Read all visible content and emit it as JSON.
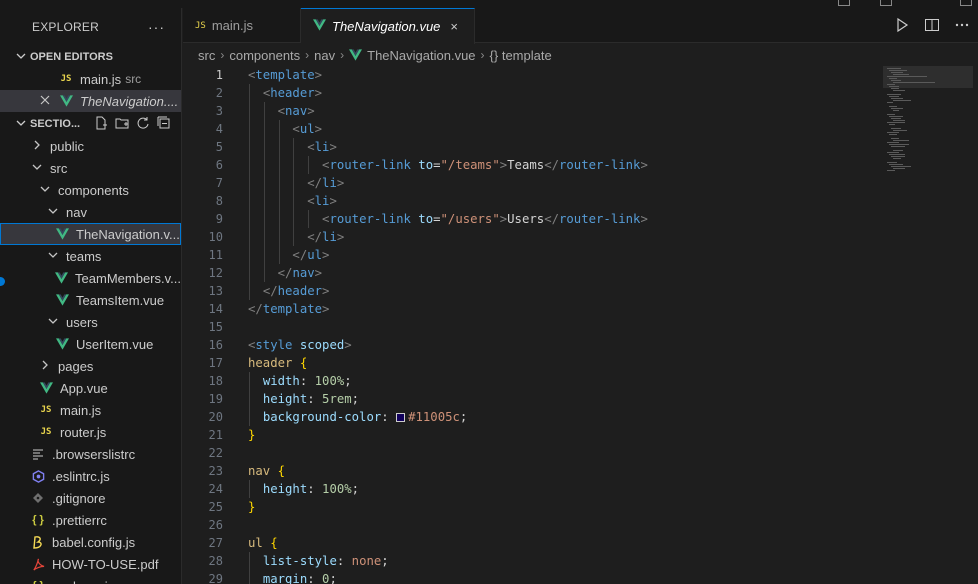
{
  "explorer": {
    "title": "EXPLORER",
    "more": "···"
  },
  "open_editors": {
    "heading": "OPEN EDITORS",
    "items": [
      {
        "name": "main.js",
        "detail": "src",
        "icon": "js-icon"
      },
      {
        "name": "TheNavigation....",
        "detail": "",
        "icon": "vue-icon"
      }
    ]
  },
  "workspace": {
    "heading": "SECTIO...",
    "tree": [
      {
        "label": "public",
        "type": "folder",
        "expanded": false,
        "indent": 1
      },
      {
        "label": "src",
        "type": "folder",
        "expanded": true,
        "indent": 1
      },
      {
        "label": "components",
        "type": "folder",
        "expanded": true,
        "indent": 2
      },
      {
        "label": "nav",
        "type": "folder",
        "expanded": true,
        "indent": 3
      },
      {
        "label": "TheNavigation.v...",
        "type": "vue",
        "indent": 4,
        "focused": true
      },
      {
        "label": "teams",
        "type": "folder",
        "expanded": true,
        "indent": 3
      },
      {
        "label": "TeamMembers.v...",
        "type": "vue",
        "indent": 4
      },
      {
        "label": "TeamsItem.vue",
        "type": "vue",
        "indent": 4
      },
      {
        "label": "users",
        "type": "folder",
        "expanded": true,
        "indent": 3
      },
      {
        "label": "UserItem.vue",
        "type": "vue",
        "indent": 4
      },
      {
        "label": "pages",
        "type": "folder",
        "expanded": false,
        "indent": 2
      },
      {
        "label": "App.vue",
        "type": "vue",
        "indent": 2
      },
      {
        "label": "main.js",
        "type": "js",
        "indent": 2
      },
      {
        "label": "router.js",
        "type": "js",
        "indent": 2
      },
      {
        "label": ".browserslistrc",
        "type": "lines",
        "indent": 1
      },
      {
        "label": ".eslintrc.js",
        "type": "eslint",
        "indent": 1
      },
      {
        "label": ".gitignore",
        "type": "git",
        "indent": 1
      },
      {
        "label": ".prettierrc",
        "type": "braces",
        "indent": 1
      },
      {
        "label": "babel.config.js",
        "type": "babel",
        "indent": 1
      },
      {
        "label": "HOW-TO-USE.pdf",
        "type": "pdf",
        "indent": 1
      },
      {
        "label": "package.json",
        "type": "braces",
        "indent": 1
      }
    ]
  },
  "tabs": [
    {
      "label": "main.js",
      "icon": "js-icon",
      "active": false
    },
    {
      "label": "TheNavigation.vue",
      "icon": "vue-icon",
      "active": true,
      "close": "×"
    }
  ],
  "breadcrumb": [
    "src",
    "components",
    "nav",
    "TheNavigation.vue",
    "{} template"
  ],
  "icon_labels": {
    "js": "JS",
    "braces": "{ }"
  },
  "code": {
    "current_line": 1,
    "lines": [
      {
        "n": "1",
        "ind": 0,
        "toks": [
          [
            "br",
            "<"
          ],
          [
            "tag",
            "template"
          ],
          [
            "br",
            ">"
          ]
        ]
      },
      {
        "n": "2",
        "ind": 1,
        "toks": [
          [
            "br",
            "<"
          ],
          [
            "tag",
            "header"
          ],
          [
            "br",
            ">"
          ]
        ]
      },
      {
        "n": "3",
        "ind": 2,
        "toks": [
          [
            "br",
            "<"
          ],
          [
            "tag",
            "nav"
          ],
          [
            "br",
            ">"
          ]
        ]
      },
      {
        "n": "4",
        "ind": 3,
        "toks": [
          [
            "br",
            "<"
          ],
          [
            "tag",
            "ul"
          ],
          [
            "br",
            ">"
          ]
        ]
      },
      {
        "n": "5",
        "ind": 4,
        "toks": [
          [
            "br",
            "<"
          ],
          [
            "tag",
            "li"
          ],
          [
            "br",
            ">"
          ]
        ]
      },
      {
        "n": "6",
        "ind": 5,
        "toks": [
          [
            "br",
            "<"
          ],
          [
            "tag",
            "router-link"
          ],
          [
            "txt",
            " "
          ],
          [
            "attr",
            "to"
          ],
          [
            "txt",
            "="
          ],
          [
            "str",
            "\"/teams\""
          ],
          [
            "br",
            ">"
          ],
          [
            "txt",
            "Teams"
          ],
          [
            "br",
            "</"
          ],
          [
            "tag",
            "router-link"
          ],
          [
            "br",
            ">"
          ]
        ]
      },
      {
        "n": "7",
        "ind": 4,
        "toks": [
          [
            "br",
            "</"
          ],
          [
            "tag",
            "li"
          ],
          [
            "br",
            ">"
          ]
        ]
      },
      {
        "n": "8",
        "ind": 4,
        "toks": [
          [
            "br",
            "<"
          ],
          [
            "tag",
            "li"
          ],
          [
            "br",
            ">"
          ]
        ]
      },
      {
        "n": "9",
        "ind": 5,
        "toks": [
          [
            "br",
            "<"
          ],
          [
            "tag",
            "router-link"
          ],
          [
            "txt",
            " "
          ],
          [
            "attr",
            "to"
          ],
          [
            "txt",
            "="
          ],
          [
            "str",
            "\"/users\""
          ],
          [
            "br",
            ">"
          ],
          [
            "txt",
            "Users"
          ],
          [
            "br",
            "</"
          ],
          [
            "tag",
            "router-link"
          ],
          [
            "br",
            ">"
          ]
        ]
      },
      {
        "n": "10",
        "ind": 4,
        "toks": [
          [
            "br",
            "</"
          ],
          [
            "tag",
            "li"
          ],
          [
            "br",
            ">"
          ]
        ]
      },
      {
        "n": "11",
        "ind": 3,
        "toks": [
          [
            "br",
            "</"
          ],
          [
            "tag",
            "ul"
          ],
          [
            "br",
            ">"
          ]
        ]
      },
      {
        "n": "12",
        "ind": 2,
        "toks": [
          [
            "br",
            "</"
          ],
          [
            "tag",
            "nav"
          ],
          [
            "br",
            ">"
          ]
        ]
      },
      {
        "n": "13",
        "ind": 1,
        "toks": [
          [
            "br",
            "</"
          ],
          [
            "tag",
            "header"
          ],
          [
            "br",
            ">"
          ]
        ]
      },
      {
        "n": "14",
        "ind": 0,
        "toks": [
          [
            "br",
            "</"
          ],
          [
            "tag",
            "template"
          ],
          [
            "br",
            ">"
          ]
        ]
      },
      {
        "n": "15",
        "ind": 0,
        "toks": []
      },
      {
        "n": "16",
        "ind": 0,
        "toks": [
          [
            "br",
            "<"
          ],
          [
            "tag",
            "style"
          ],
          [
            "txt",
            " "
          ],
          [
            "attr",
            "scoped"
          ],
          [
            "br",
            ">"
          ]
        ]
      },
      {
        "n": "17",
        "ind": 0,
        "toks": [
          [
            "sel",
            "header"
          ],
          [
            "txt",
            " "
          ],
          [
            "bracey",
            "{"
          ]
        ]
      },
      {
        "n": "18",
        "ind": 1,
        "toks": [
          [
            "prop",
            "width"
          ],
          [
            "txt",
            ": "
          ],
          [
            "num",
            "100%"
          ],
          [
            "txt",
            ";"
          ]
        ]
      },
      {
        "n": "19",
        "ind": 1,
        "toks": [
          [
            "prop",
            "height"
          ],
          [
            "txt",
            ": "
          ],
          [
            "num",
            "5rem"
          ],
          [
            "txt",
            ";"
          ]
        ]
      },
      {
        "n": "20",
        "ind": 1,
        "toks": [
          [
            "prop",
            "background-color"
          ],
          [
            "txt",
            ": "
          ],
          [
            "swatch",
            ""
          ],
          [
            "kw",
            "#11005c"
          ],
          [
            "txt",
            ";"
          ]
        ]
      },
      {
        "n": "21",
        "ind": 0,
        "toks": [
          [
            "bracey",
            "}"
          ]
        ]
      },
      {
        "n": "22",
        "ind": 0,
        "toks": []
      },
      {
        "n": "23",
        "ind": 0,
        "toks": [
          [
            "sel",
            "nav"
          ],
          [
            "txt",
            " "
          ],
          [
            "bracey",
            "{"
          ]
        ]
      },
      {
        "n": "24",
        "ind": 1,
        "toks": [
          [
            "prop",
            "height"
          ],
          [
            "txt",
            ": "
          ],
          [
            "num",
            "100%"
          ],
          [
            "txt",
            ";"
          ]
        ]
      },
      {
        "n": "25",
        "ind": 0,
        "toks": [
          [
            "bracey",
            "}"
          ]
        ]
      },
      {
        "n": "26",
        "ind": 0,
        "toks": []
      },
      {
        "n": "27",
        "ind": 0,
        "toks": [
          [
            "sel",
            "ul"
          ],
          [
            "txt",
            " "
          ],
          [
            "bracey",
            "{"
          ]
        ]
      },
      {
        "n": "28",
        "ind": 1,
        "toks": [
          [
            "prop",
            "list-style"
          ],
          [
            "txt",
            ": "
          ],
          [
            "kw",
            "none"
          ],
          [
            "txt",
            ";"
          ]
        ]
      },
      {
        "n": "29",
        "ind": 1,
        "toks": [
          [
            "prop",
            "margin"
          ],
          [
            "txt",
            ": "
          ],
          [
            "num",
            "0"
          ],
          [
            "txt",
            ";"
          ]
        ]
      }
    ]
  },
  "colors": {
    "accent": "#0078d4",
    "vue": "#41b883",
    "js": "#e8d44d",
    "swatch": "#11005c"
  }
}
